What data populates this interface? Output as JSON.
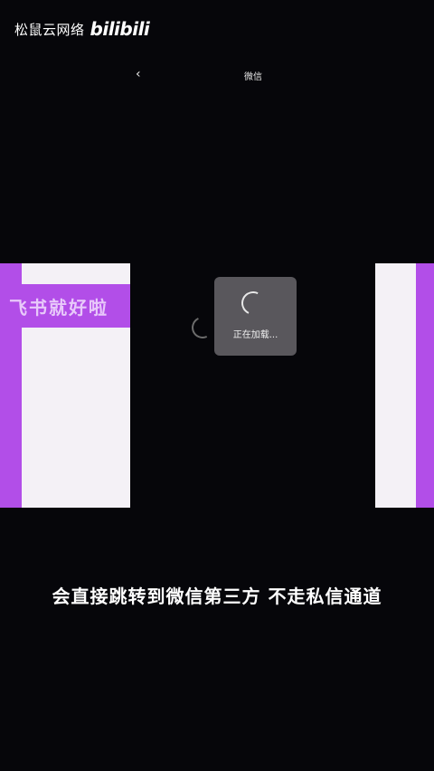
{
  "watermark": {
    "text": "松鼠云网络",
    "logo": "bilibili"
  },
  "topbar": {
    "back_icon": "‹",
    "title": "微信"
  },
  "left_card": {
    "banner_text": "飞书就好啦"
  },
  "loading": {
    "text": "正在加载..."
  },
  "subtitle": {
    "text": "会直接跳转到微信第三方 不走私信通道"
  },
  "colors": {
    "accent": "#b24ee8",
    "card_bg": "#f4f1f6",
    "loading_bg": "#59575c",
    "background": "#06060a"
  }
}
